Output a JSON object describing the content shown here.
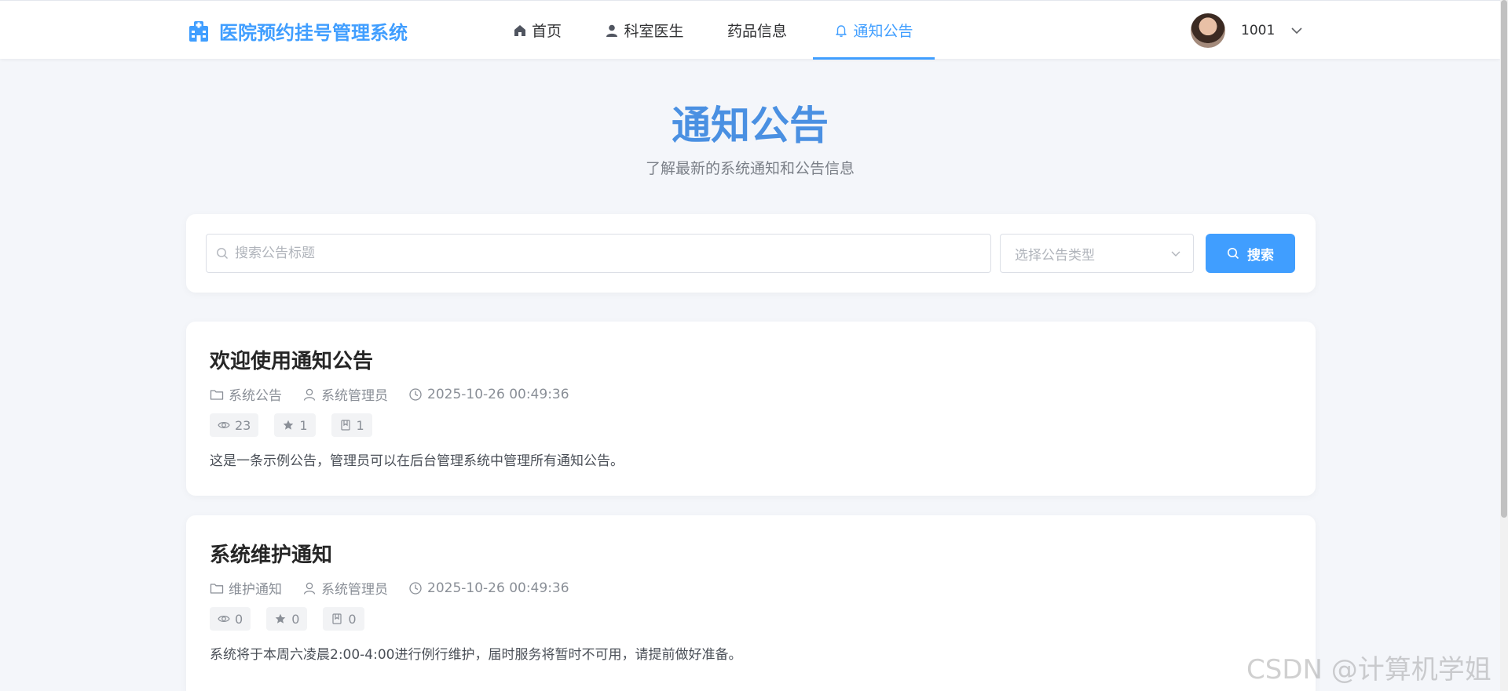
{
  "header": {
    "brand": "医院预约挂号管理系统",
    "nav": [
      {
        "label": "首页",
        "icon": "home-icon"
      },
      {
        "label": "科室医生",
        "icon": "user-icon"
      },
      {
        "label": "药品信息",
        "icon": ""
      },
      {
        "label": "通知公告",
        "icon": "bell-icon",
        "active": true
      }
    ],
    "user_name": "1001"
  },
  "page": {
    "title": "通知公告",
    "subtitle": "了解最新的系统通知和公告信息"
  },
  "search": {
    "placeholder": "搜索公告标题",
    "value": "",
    "type_placeholder": "选择公告类型",
    "button_label": "搜索"
  },
  "notices": [
    {
      "title": "欢迎使用通知公告",
      "category": "系统公告",
      "author": "系统管理员",
      "time": "2025-10-26 00:49:36",
      "views": "23",
      "likes": "1",
      "favorites": "1",
      "content": "这是一条示例公告，管理员可以在后台管理系统中管理所有通知公告。"
    },
    {
      "title": "系统维护通知",
      "category": "维护通知",
      "author": "系统管理员",
      "time": "2025-10-26 00:49:36",
      "views": "0",
      "likes": "0",
      "favorites": "0",
      "content": "系统将于本周六凌晨2:00-4:00进行例行维护，届时服务将暂时不可用，请提前做好准备。"
    }
  ],
  "watermark": "CSDN @计算机学姐",
  "colors": {
    "accent": "#409eff",
    "title": "#4a90e2",
    "background": "#f4f6fa"
  }
}
